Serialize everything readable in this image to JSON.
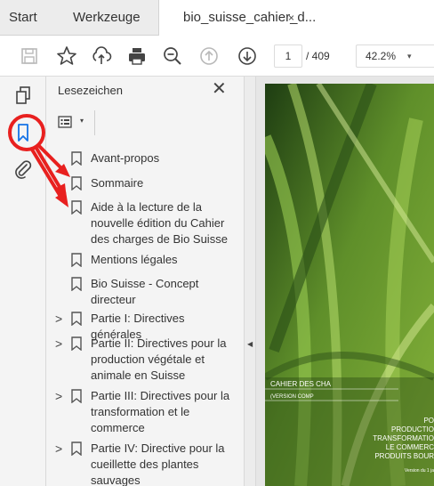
{
  "tabs": {
    "start": "Start",
    "tools": "Werkzeuge",
    "document": "bio_suisse_cahier_d...",
    "close": "×"
  },
  "toolbar": {
    "icons": [
      "save-icon",
      "star-icon",
      "cloud-upload-icon",
      "print-icon",
      "zoom-out-icon",
      "page-up-icon",
      "page-down-icon"
    ],
    "page_current": "1",
    "page_total": "/ 409",
    "zoom": "42.2%",
    "zoom_caret": "▾"
  },
  "rail": {
    "icons": [
      "copy-pages-icon",
      "bookmark-icon",
      "attachment-icon"
    ]
  },
  "bookmarks_panel": {
    "title": "Lesezeichen",
    "close": "✕",
    "options_caret": "▾",
    "items": [
      {
        "label": "Avant-propos",
        "expandable": false
      },
      {
        "label": "Sommaire",
        "expandable": false
      },
      {
        "label": "Aide à la lecture de la nouvelle édition du Cahier des charges de Bio Suisse",
        "expandable": false
      },
      {
        "label": "Mentions légales",
        "expandable": false
      },
      {
        "label": "Bio Suisse - Concept directeur",
        "expandable": false
      },
      {
        "label": "Partie I: Directives générales",
        "expandable": true
      },
      {
        "label": "Partie II: Directives pour la production végétale et animale en Suisse",
        "expandable": true
      },
      {
        "label": "Partie III: Directives pour la transformation et le commerce",
        "expandable": true
      },
      {
        "label": "Partie IV: Directive pour la cueillette des plantes sauvages",
        "expandable": true
      }
    ],
    "expand_glyph": ">"
  },
  "splitter": {
    "arrow": "◀"
  },
  "cover": {
    "line1": "CAHIER DES CHA",
    "line2": "(VERSION COMP",
    "right_lines": [
      "PO",
      "PRODUCTIO",
      "TRANSFORMATIO",
      "LE COMMERC",
      "PRODUITS BOUR"
    ],
    "footer": "Version du 1 ja"
  },
  "colors": {
    "annotation_red": "#e8201f",
    "bookmark_blue": "#1473e6",
    "cover_green": "#3f6b1f"
  }
}
